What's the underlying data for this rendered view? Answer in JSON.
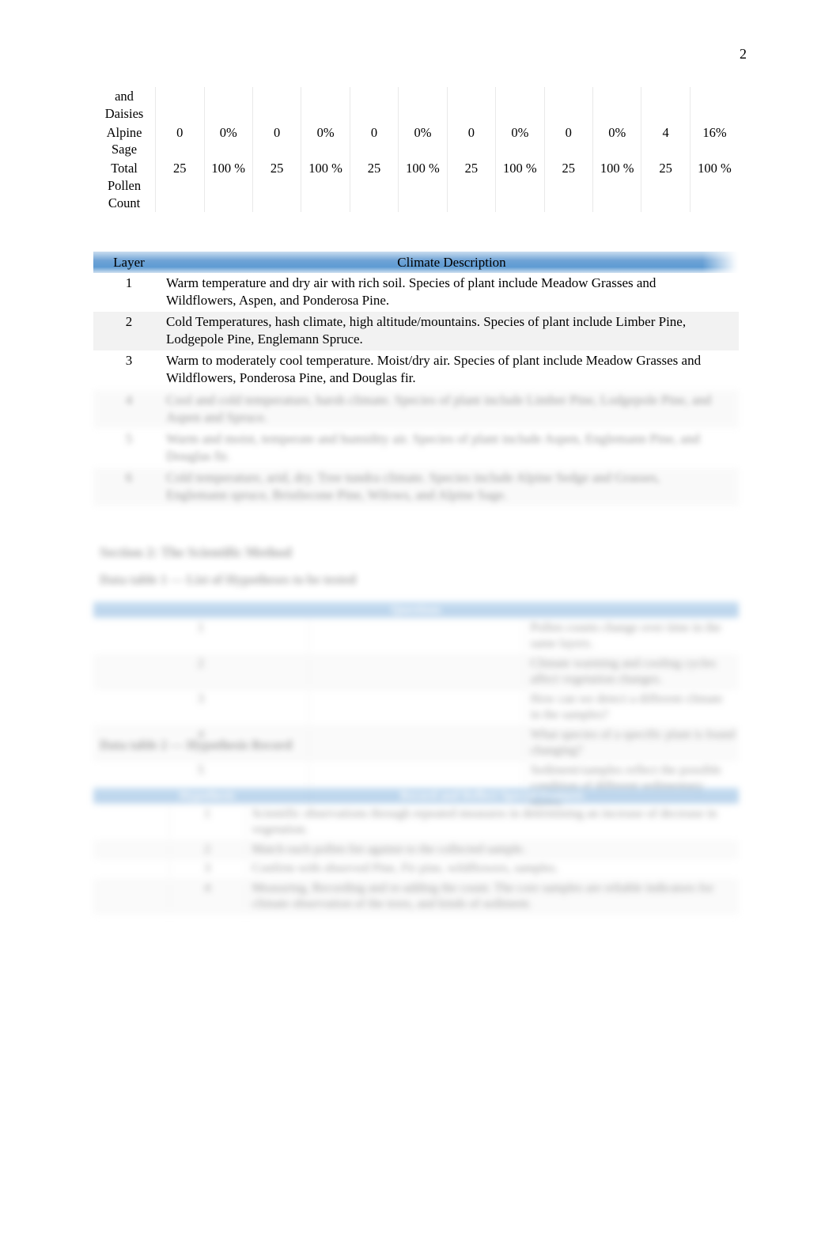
{
  "page": {
    "number": "2"
  },
  "pollen_table": {
    "rows": [
      {
        "label": "and Daisies",
        "values": [
          "",
          "",
          "",
          "",
          "",
          "",
          "",
          "",
          "",
          "",
          "",
          ""
        ]
      },
      {
        "label": "Alpine Sage",
        "values": [
          "0",
          "0%",
          "0",
          "0%",
          "0",
          "0%",
          "0",
          "0%",
          "0",
          "0%",
          "4",
          "16%"
        ]
      },
      {
        "label": "Total Pollen Count",
        "values": [
          "25",
          "100 %",
          "25",
          "100 %",
          "25",
          "100 %",
          "25",
          "100 %",
          "25",
          "100 %",
          "25",
          "100 %"
        ]
      }
    ]
  },
  "climate_table": {
    "headers": {
      "layer": "Layer",
      "description": "Climate Description"
    },
    "rows": [
      {
        "layer": "1",
        "description": "Warm temperature and dry air with rich soil. Species of plant include Meadow Grasses and Wildflowers, Aspen, and Ponderosa Pine.",
        "legible": true
      },
      {
        "layer": "2",
        "description": "Cold Temperatures, hash climate, high altitude/mountains. Species of plant include Limber Pine, Lodgepole Pine, Englemann Spruce.",
        "legible": true
      },
      {
        "layer": "3",
        "description": "Warm to moderately cool temperature. Moist/dry air. Species of plant include Meadow Grasses and Wildflowers, Ponderosa Pine, and Douglas fir.",
        "legible": true
      },
      {
        "layer": "4",
        "description": "Cool and cold temperature, harsh climate. Species of plant include Limber Pine, Lodgepole Pine, and Aspen and Spruce.",
        "legible": false
      },
      {
        "layer": "5",
        "description": "Warm and moist, temperate and humidity air. Species of plant include Aspen, Englemann Pine, and Douglas fir.",
        "legible": false
      },
      {
        "layer": "6",
        "description": "Cold temperature, arid, dry. Tree tundra climate. Species include Alpine Sedge and Grasses, Englemann spruce, Bristlecone Pine, Wilows, and Alpine Sage.",
        "legible": false
      }
    ]
  },
  "section": {
    "heading": "Section 2: The Scientific Method",
    "caption_questions": "Data table 1 — List of Hypotheses to be tested",
    "caption_hypothesis": "Data table 2 — Hypothesis Record"
  },
  "question_table": {
    "header": "Questions",
    "rows": [
      {
        "num": "1",
        "mark": "",
        "text": "Pollen counts change over time in the same layers.",
        "legible": false
      },
      {
        "num": "2",
        "mark": "",
        "text": "Climate warming and cooling cycles affect vegetation changes.",
        "legible": false
      },
      {
        "num": "3",
        "mark": "",
        "text": "How can we detect a different climate in the samples?",
        "legible": false
      },
      {
        "num": "4",
        "mark": "",
        "text": "What species of a specific plant is found changing?",
        "legible": false
      },
      {
        "num": "5",
        "mark": "",
        "text": "Sediment/samples reflect the possible condition of different sedimentary layers.",
        "legible": false
      }
    ]
  },
  "hypothesis_table": {
    "headers": {
      "blank": "",
      "hypothesis": "Hypothesis",
      "record": "Record and Reflect Special Features"
    },
    "rows": [
      {
        "num": "",
        "mark": "1",
        "text": "Scientific observations through repeated measures in determining an increase of decrease in vegetation.",
        "legible": false
      },
      {
        "num": "",
        "mark": "2",
        "text": "Match each pollen list against to the collected sample.",
        "legible": false
      },
      {
        "num": "",
        "mark": "3",
        "text": "Confirm with observed Pine, Fir pine, wildflowers, samples.",
        "legible": false
      },
      {
        "num": "",
        "mark": "4",
        "text": "Measuring, Recording and re-adding the count. The core samples are reliable indicators for climate observation of the trees, and kinds of sediment.",
        "legible": false
      }
    ]
  }
}
